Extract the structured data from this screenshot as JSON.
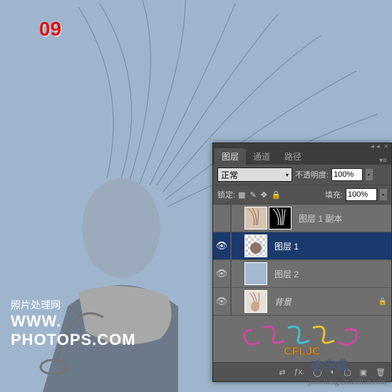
{
  "step_number": "09",
  "watermark": {
    "line1": "照片处理网",
    "line2": "WWW.",
    "line3": "PHOTOPS.COM"
  },
  "panel": {
    "tabs": [
      "图层",
      "通道",
      "路径"
    ],
    "active_tab": 0,
    "blend_mode": "正常",
    "opacity_label": "不透明度:",
    "opacity_value": "100%",
    "lock_label": "锁定:",
    "fill_label": "填充:",
    "fill_value": "100%",
    "layers": [
      {
        "visible": false,
        "has_mask": true,
        "name": "图层 1 副本",
        "selected": false,
        "thumb": "hair",
        "mask": "maskhair"
      },
      {
        "visible": true,
        "has_mask": false,
        "name": "图层 1",
        "selected": true,
        "thumb": "checker"
      },
      {
        "visible": true,
        "has_mask": false,
        "name": "图层 2",
        "selected": false,
        "thumb": "solid"
      },
      {
        "visible": true,
        "has_mask": false,
        "name": "背景",
        "selected": false,
        "thumb": "hair2",
        "locked": true,
        "italic": true
      }
    ],
    "footer_icons": [
      "link",
      "fx",
      "mask",
      "adjust",
      "group",
      "new",
      "trash"
    ]
  },
  "decor_text": "CFLJC",
  "bottom_watermark": "jiaocheng.chazidian.com",
  "dict_logo": "查字典"
}
